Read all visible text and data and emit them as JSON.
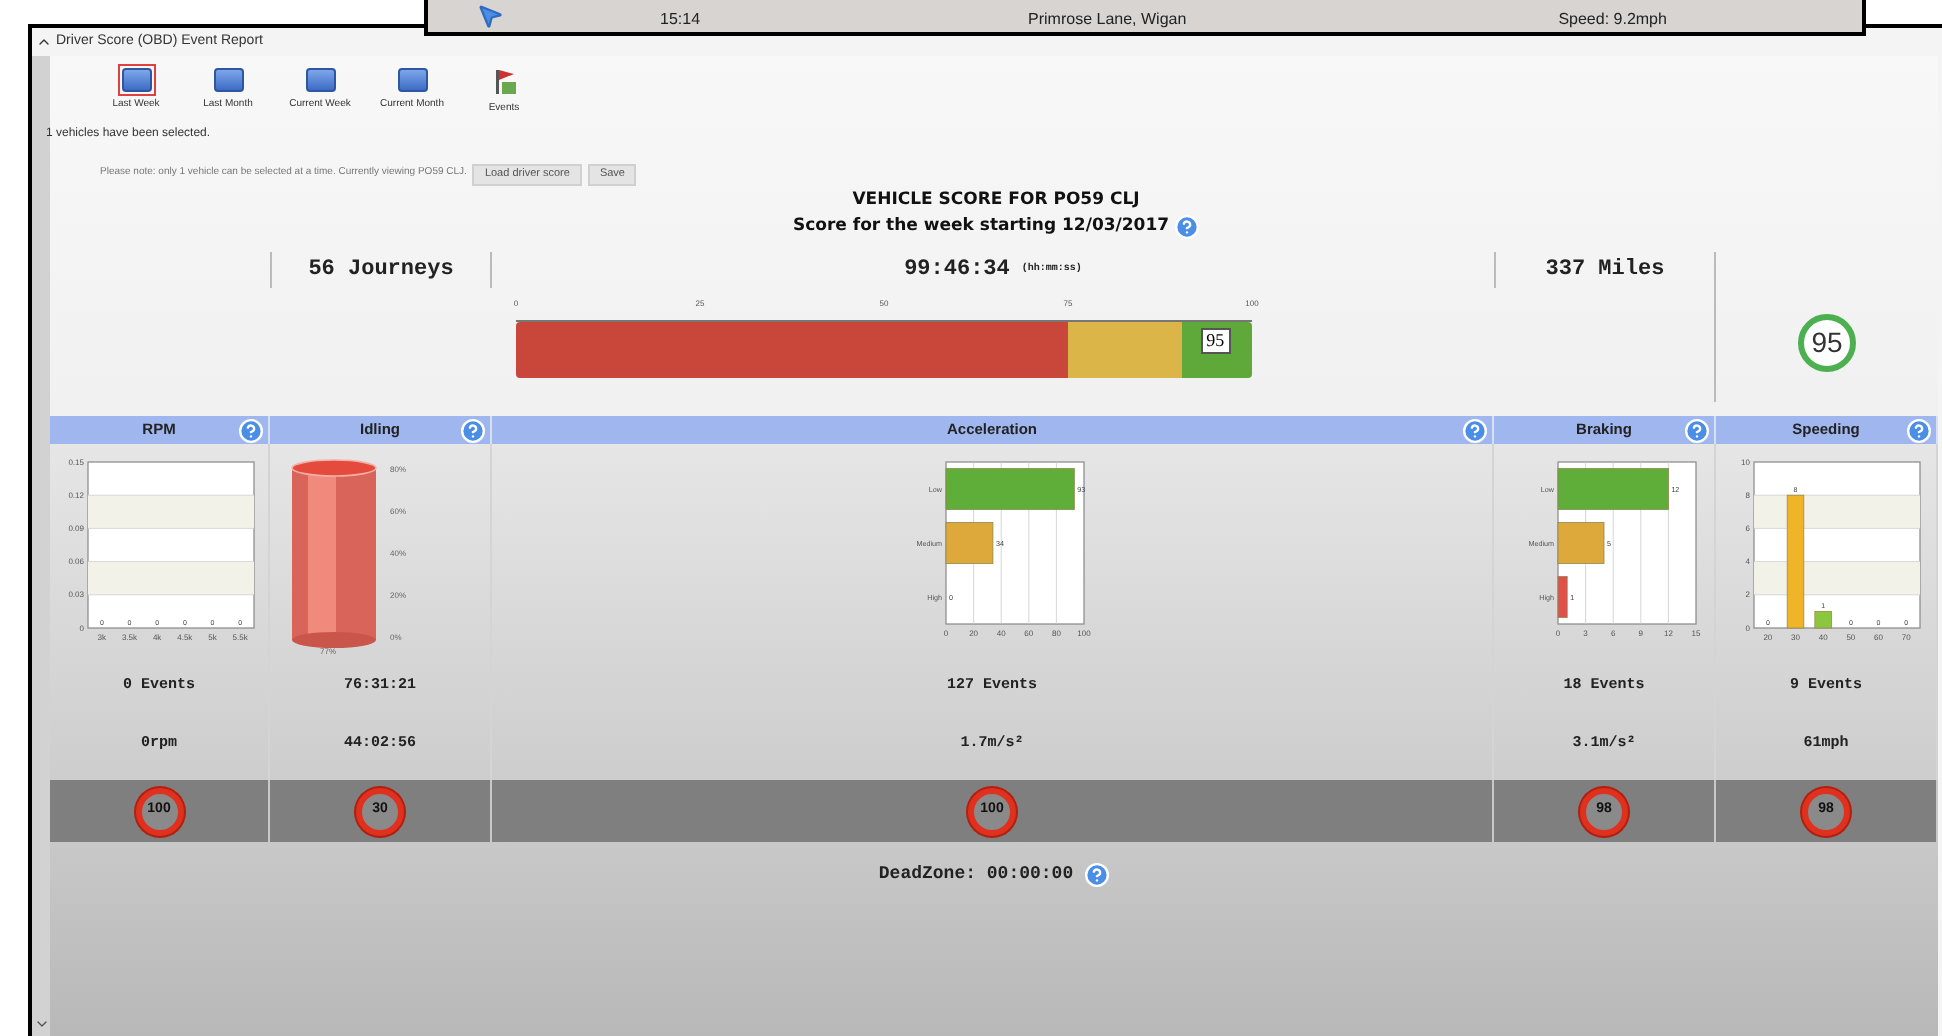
{
  "popup": {
    "time": "15:14",
    "location": "Primrose Lane, Wigan",
    "speed": "Speed: 9.2mph"
  },
  "report": {
    "title": "Driver Score (OBD) Event Report",
    "expanded": true
  },
  "periods": [
    {
      "label": "Last Week",
      "kind": "calendar",
      "selected": true
    },
    {
      "label": "Last Month",
      "kind": "calendar",
      "selected": false
    },
    {
      "label": "Current Week",
      "kind": "calendar",
      "selected": false
    },
    {
      "label": "Current Month",
      "kind": "calendar",
      "selected": false
    },
    {
      "label": "Events",
      "kind": "flag",
      "selected": false
    }
  ],
  "selection_note": "1 vehicles have been selected.",
  "viewing_note": "Please note: only 1 vehicle can be selected at a time. Currently viewing PO59 CLJ.",
  "buttons": [
    "Load driver score",
    "Save"
  ],
  "heading": "VEHICLE SCORE FOR PO59 CLJ",
  "subheading": "Score for the week starting 12/03/2017",
  "stats": {
    "journeys": "56 Journeys",
    "duration": "99:46:34",
    "duration_unit": "(hh:mm:ss)",
    "distance": "337 Miles"
  },
  "score_bar": {
    "ticks": [
      "0",
      "25",
      "50",
      "75",
      "100"
    ],
    "bands": [
      {
        "color": "#c9463a"
      },
      {
        "color": "#dcb548"
      },
      {
        "color": "#5fa83a"
      }
    ],
    "marker": {
      "label": "95"
    }
  },
  "overall_score": "95",
  "columns": [
    {
      "title": "RPM",
      "kind": "vbar",
      "events": "0 Events",
      "value": "0rpm",
      "score": "100",
      "chart_data": {
        "type": "bar",
        "orientation": "vertical",
        "categories": [
          "3k",
          "3.5k",
          "4k",
          "4.5k",
          "5k",
          "5.5k"
        ],
        "values": [
          0,
          0,
          0,
          0,
          0,
          0
        ],
        "ylim": [
          0,
          0.15
        ],
        "yticks": [
          0,
          0.03,
          0.06,
          0.09,
          0.12,
          0.15
        ],
        "grid": true,
        "data_labels": true
      }
    },
    {
      "title": "Idling",
      "kind": "cylinder",
      "events": "76:31:21",
      "value": "44:02:56",
      "score": "30",
      "gauge": {
        "ticks": [
          "80%",
          "60%",
          "40%",
          "20%",
          "0%"
        ],
        "label": "77%"
      }
    },
    {
      "title": "Acceleration",
      "kind": "hbar",
      "events": "127 Events",
      "value": "1.7m/s²",
      "score": "100",
      "chart_data": {
        "type": "bar",
        "orientation": "horizontal",
        "categories": [
          "Low",
          "Medium",
          "High"
        ],
        "values": [
          93,
          34,
          0
        ],
        "colors": [
          "#5fae3a",
          "#dca93a",
          null
        ],
        "xlim": [
          0,
          100
        ],
        "xticks": [
          0,
          20,
          40,
          60,
          80,
          100
        ],
        "grid": true,
        "data_labels": true
      }
    },
    {
      "title": "Braking",
      "kind": "hbar",
      "events": "18 Events",
      "value": "3.1m/s²",
      "score": "98",
      "chart_data": {
        "type": "bar",
        "orientation": "horizontal",
        "categories": [
          "Low",
          "Medium",
          "High"
        ],
        "values": [
          12,
          5,
          1
        ],
        "colors": [
          "#5fae3a",
          "#dca93a",
          "#e0504a"
        ],
        "xlim": [
          0,
          15
        ],
        "xticks": [
          0,
          3,
          6,
          9,
          12,
          15
        ],
        "grid": true,
        "data_labels": true
      }
    },
    {
      "title": "Speeding",
      "kind": "vbar",
      "events": "9 Events",
      "value": "61mph",
      "score": "98",
      "chart_data": {
        "type": "bar",
        "orientation": "vertical",
        "categories": [
          "20",
          "30",
          "40",
          "50",
          "60",
          "70"
        ],
        "values": [
          0,
          8,
          1,
          0,
          0,
          0
        ],
        "colors": [
          null,
          "#f0b429",
          "#8cc63f",
          null,
          null,
          null
        ],
        "ylim": [
          0,
          10
        ],
        "yticks": [
          0,
          2,
          4,
          6,
          8,
          10
        ],
        "grid": true,
        "data_labels": true
      }
    }
  ],
  "deadzone": "DeadZone: 00:00:00"
}
